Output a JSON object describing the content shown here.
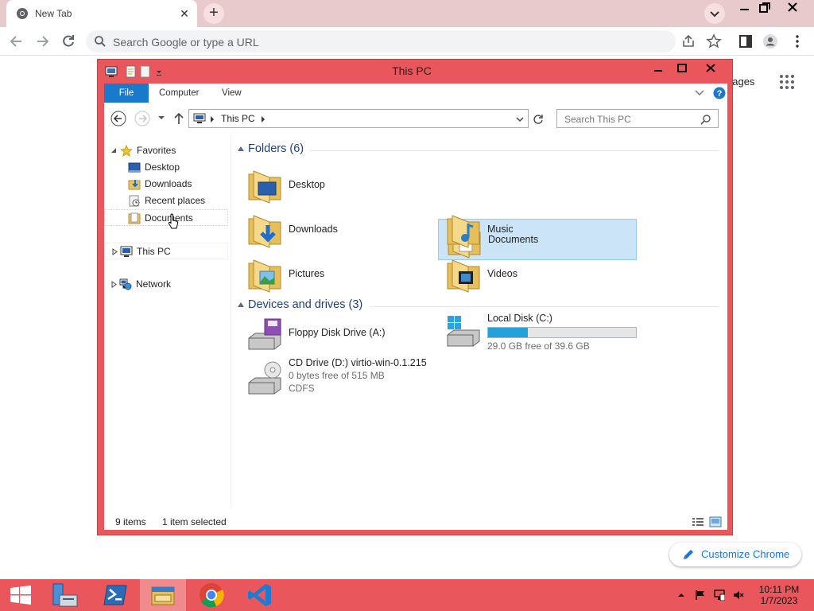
{
  "browser": {
    "tab_title": "New Tab",
    "tab_close": "✕",
    "new_tab": "+",
    "omnibox_placeholder": "Search Google or type a URL",
    "ntp_images_link": "nages",
    "customize_label": "Customize Chrome"
  },
  "explorer": {
    "title": "This PC",
    "ribbon_tabs": [
      "File",
      "Computer",
      "View"
    ],
    "breadcrumb": "This PC",
    "search_placeholder": "Search This PC",
    "nav": {
      "favorites": "Favorites",
      "favorite_items": [
        "Desktop",
        "Downloads",
        "Recent places",
        "Documents"
      ],
      "this_pc": "This PC",
      "network": "Network"
    },
    "folders_header": "Folders (6)",
    "folders": [
      {
        "name": "Desktop",
        "icon": "desktop-folder-icon"
      },
      {
        "name": "Documents",
        "icon": "documents-folder-icon",
        "selected": true
      },
      {
        "name": "Downloads",
        "icon": "downloads-folder-icon"
      },
      {
        "name": "Music",
        "icon": "music-folder-icon"
      },
      {
        "name": "Pictures",
        "icon": "pictures-folder-icon"
      },
      {
        "name": "Videos",
        "icon": "videos-folder-icon"
      }
    ],
    "devices_header": "Devices and drives (3)",
    "drives": {
      "floppy": {
        "name": "Floppy Disk Drive (A:)"
      },
      "local": {
        "name": "Local Disk (C:)",
        "free_text": "29.0 GB free of 39.6 GB",
        "used_fraction": 0.27
      },
      "cd": {
        "name": "CD Drive (D:) virtio-win-0.1.215",
        "free_text": "0 bytes free of 515 MB",
        "fs": "CDFS"
      }
    },
    "status": {
      "items": "9 items",
      "selected": "1 item selected"
    }
  },
  "taskbar": {
    "apps": [
      "Server Manager",
      "PowerShell",
      "File Explorer",
      "Google Chrome",
      "Visual Studio Code"
    ],
    "active_app": "File Explorer",
    "clock_time": "10:11 PM",
    "clock_date": "1/7/2023"
  },
  "colors": {
    "accent": "#1979ca",
    "window_frame": "#e9565b",
    "selection": "#cce4f7"
  }
}
